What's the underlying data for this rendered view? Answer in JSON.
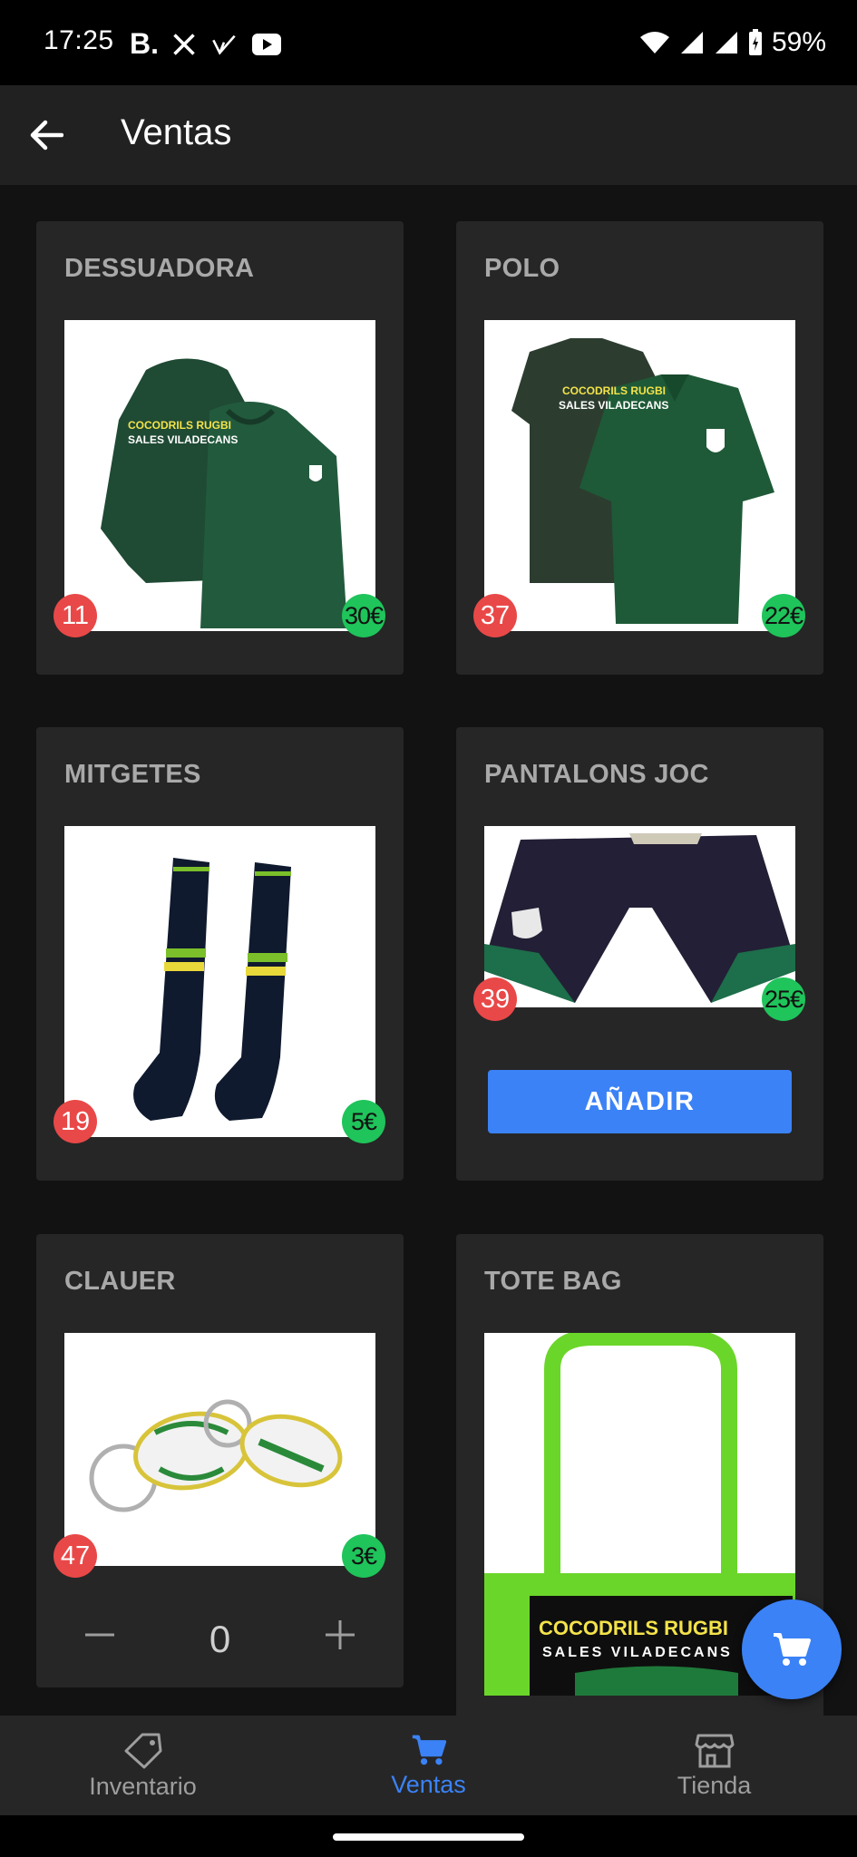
{
  "status_bar": {
    "time": "17:25",
    "app_letter": "B.",
    "battery": "59%"
  },
  "app_bar": {
    "title": "Ventas"
  },
  "products": [
    {
      "name": "DESSUADORA",
      "stock": "11",
      "price": "30€",
      "print_line1": "COCODRILS RUGBI",
      "print_line2": "SALES VILADECANS"
    },
    {
      "name": "POLO",
      "stock": "37",
      "price": "22€",
      "print_line1": "COCODRILS RUGBI",
      "print_line2": "SALES VILADECANS"
    },
    {
      "name": "MITGETES",
      "stock": "19",
      "price": "5€"
    },
    {
      "name": "PANTALONS JOC",
      "stock": "39",
      "price": "25€",
      "button": "AÑADIR"
    },
    {
      "name": "CLAUER",
      "stock": "47",
      "price": "3€",
      "quantity": "0"
    },
    {
      "name": "TOTE BAG",
      "print_line1": "COCODRILS RUGBI",
      "print_line2": "SALES VILADECANS"
    }
  ],
  "nav": {
    "items": [
      {
        "label": "Inventario",
        "icon": "tag-icon",
        "active": false
      },
      {
        "label": "Ventas",
        "icon": "cart-icon",
        "active": true
      },
      {
        "label": "Tienda",
        "icon": "store-icon",
        "active": false
      }
    ]
  },
  "colors": {
    "accent": "#3b82f6",
    "stock_badge": "#e94848",
    "price_badge": "#1fc45b",
    "card": "#262626",
    "background": "#121212"
  }
}
